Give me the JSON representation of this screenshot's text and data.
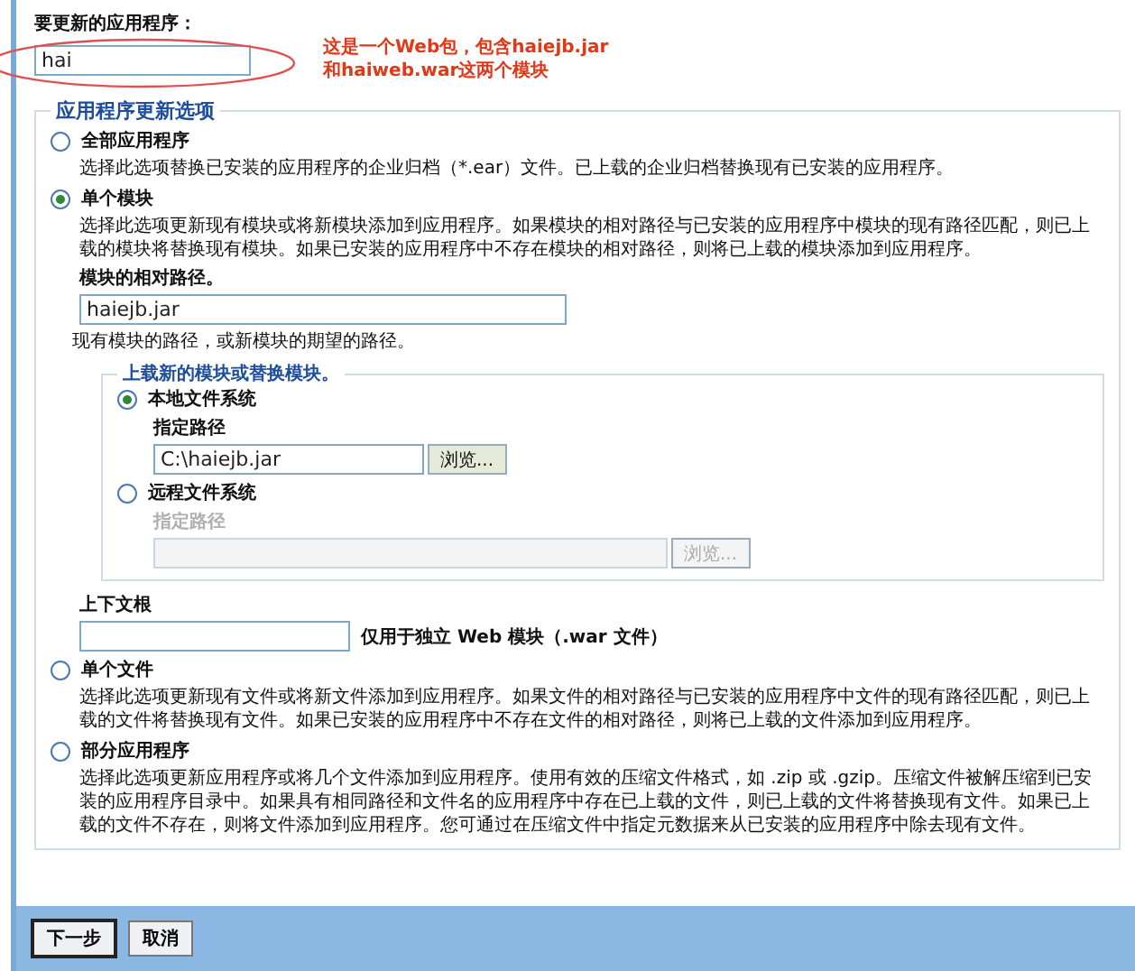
{
  "application_field": {
    "label": "要更新的应用程序：",
    "value": "hai"
  },
  "annotation": {
    "lines": [
      "这是一个Web包，包含haiejb.jar",
      "和haiweb.war这两个模块"
    ]
  },
  "update_options": {
    "legend": "应用程序更新选项",
    "options": [
      {
        "kind": "simple",
        "label": "全部应用程序",
        "selected": false,
        "description": "选择此选项替换已安装的应用程序的企业归档（*.ear）文件。已上载的企业归档替换现有已安装的应用程序。"
      },
      {
        "kind": "module",
        "label": "单个模块",
        "selected": true,
        "description": "选择此选项更新现有模块或将新模块添加到应用程序。如果模块的相对路径与已安装的应用程序中模块的现有路径匹配，则已上载的模块将替换现有模块。如果已安装的应用程序中不存在模块的相对路径，则将已上载的模块添加到应用程序。",
        "path_field": {
          "label": "模块的相对路径。",
          "value": "haiejb.jar",
          "hint": "现有模块的路径，或新模块的期望的路径。"
        },
        "upload": {
          "legend": "上载新的模块或替换模块。",
          "sources": [
            {
              "label": "本地文件系统",
              "selected": true,
              "field_label": "指定路径",
              "value": "C:\\haiejb.jar",
              "browse": "浏览...",
              "disabled": false
            },
            {
              "label": "远程文件系统",
              "selected": false,
              "field_label": "指定路径",
              "browse": "浏览...",
              "disabled": true
            }
          ]
        },
        "context_root": {
          "label": "上下文根",
          "note": "仅用于独立 Web 模块（.war 文件）"
        }
      },
      {
        "kind": "simple",
        "label": "单个文件",
        "selected": false,
        "description": "选择此选项更新现有文件或将新文件添加到应用程序。如果文件的相对路径与已安装的应用程序中文件的现有路径匹配，则已上载的文件将替换现有文件。如果已安装的应用程序中不存在文件的相对路径，则将已上载的文件添加到应用程序。"
      },
      {
        "kind": "simple",
        "label": "部分应用程序",
        "selected": false,
        "description": "选择此选项更新应用程序或将几个文件添加到应用程序。使用有效的压缩文件格式，如 .zip 或 .gzip。压缩文件被解压缩到已安装的应用程序目录中。如果具有相同路径和文件名的应用程序中存在已上载的文件，则已上载的文件将替换现有文件。如果已上载的文件不存在，则将文件添加到应用程序。您可通过在压缩文件中指定元数据来从已安装的应用程序中除去现有文件。"
      }
    ]
  },
  "buttons": [
    {
      "label": "下一步",
      "default": true
    },
    {
      "label": "取消",
      "default": false
    }
  ]
}
